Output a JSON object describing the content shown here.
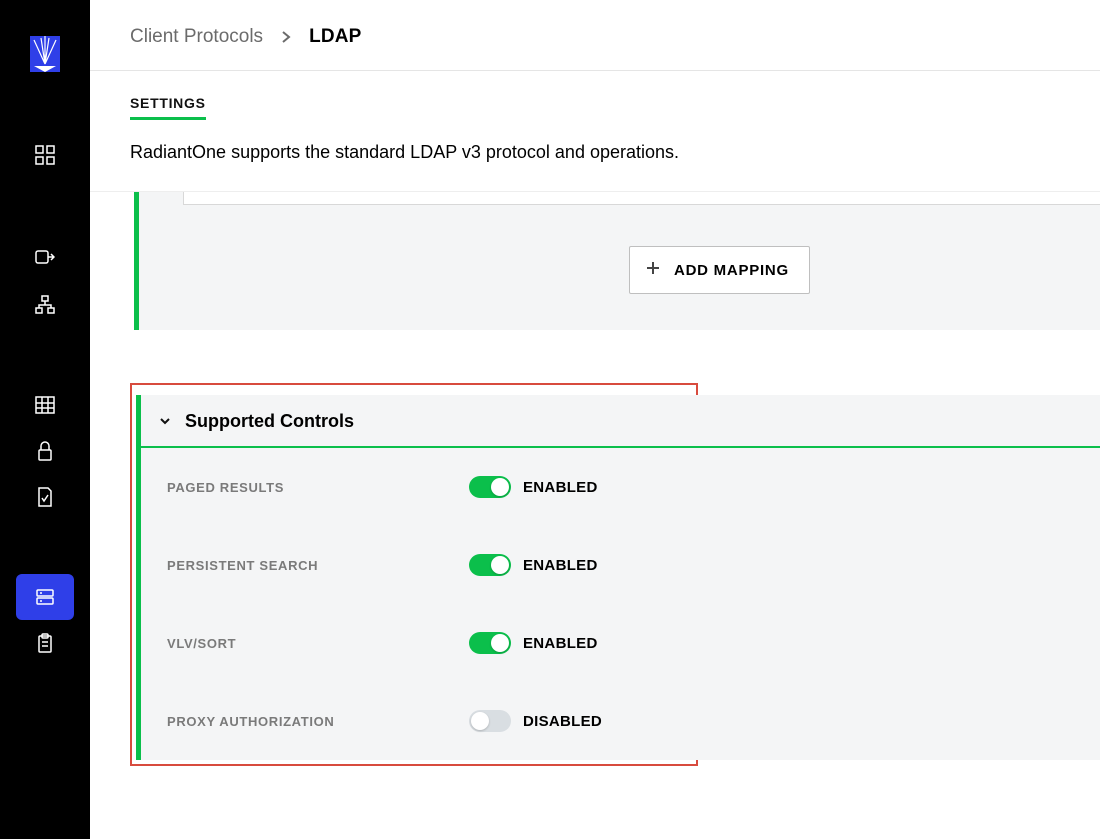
{
  "breadcrumb": {
    "parent": "Client Protocols",
    "current": "LDAP"
  },
  "tab": {
    "label": "SETTINGS"
  },
  "description": "RadiantOne supports the standard LDAP v3 protocol and operations.",
  "buttons": {
    "add_mapping": "ADD MAPPING"
  },
  "supported_controls": {
    "title": "Supported Controls",
    "items": [
      {
        "label": "PAGED RESULTS",
        "enabled": true,
        "status": "ENABLED"
      },
      {
        "label": "PERSISTENT SEARCH",
        "enabled": true,
        "status": "ENABLED"
      },
      {
        "label": "VLV/SORT",
        "enabled": true,
        "status": "ENABLED"
      },
      {
        "label": "PROXY AUTHORIZATION",
        "enabled": false,
        "status": "DISABLED"
      }
    ]
  },
  "colors": {
    "accent_green": "#0bbf4b",
    "highlight_red": "#d84b3e",
    "active_nav": "#2f3fe8"
  }
}
